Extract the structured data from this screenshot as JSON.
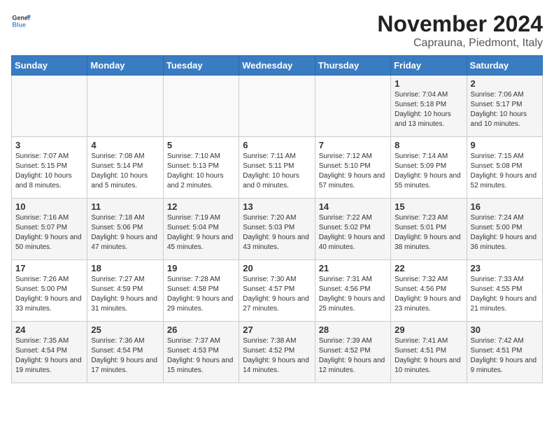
{
  "header": {
    "logo": {
      "text_general": "General",
      "text_blue": "Blue"
    },
    "title": "November 2024",
    "subtitle": "Caprauna, Piedmont, Italy"
  },
  "calendar": {
    "weekdays": [
      "Sunday",
      "Monday",
      "Tuesday",
      "Wednesday",
      "Thursday",
      "Friday",
      "Saturday"
    ],
    "weeks": [
      [
        {
          "day": "",
          "info": ""
        },
        {
          "day": "",
          "info": ""
        },
        {
          "day": "",
          "info": ""
        },
        {
          "day": "",
          "info": ""
        },
        {
          "day": "",
          "info": ""
        },
        {
          "day": "1",
          "info": "Sunrise: 7:04 AM\nSunset: 5:18 PM\nDaylight: 10 hours and 13 minutes."
        },
        {
          "day": "2",
          "info": "Sunrise: 7:06 AM\nSunset: 5:17 PM\nDaylight: 10 hours and 10 minutes."
        }
      ],
      [
        {
          "day": "3",
          "info": "Sunrise: 7:07 AM\nSunset: 5:15 PM\nDaylight: 10 hours and 8 minutes."
        },
        {
          "day": "4",
          "info": "Sunrise: 7:08 AM\nSunset: 5:14 PM\nDaylight: 10 hours and 5 minutes."
        },
        {
          "day": "5",
          "info": "Sunrise: 7:10 AM\nSunset: 5:13 PM\nDaylight: 10 hours and 2 minutes."
        },
        {
          "day": "6",
          "info": "Sunrise: 7:11 AM\nSunset: 5:11 PM\nDaylight: 10 hours and 0 minutes."
        },
        {
          "day": "7",
          "info": "Sunrise: 7:12 AM\nSunset: 5:10 PM\nDaylight: 9 hours and 57 minutes."
        },
        {
          "day": "8",
          "info": "Sunrise: 7:14 AM\nSunset: 5:09 PM\nDaylight: 9 hours and 55 minutes."
        },
        {
          "day": "9",
          "info": "Sunrise: 7:15 AM\nSunset: 5:08 PM\nDaylight: 9 hours and 52 minutes."
        }
      ],
      [
        {
          "day": "10",
          "info": "Sunrise: 7:16 AM\nSunset: 5:07 PM\nDaylight: 9 hours and 50 minutes."
        },
        {
          "day": "11",
          "info": "Sunrise: 7:18 AM\nSunset: 5:06 PM\nDaylight: 9 hours and 47 minutes."
        },
        {
          "day": "12",
          "info": "Sunrise: 7:19 AM\nSunset: 5:04 PM\nDaylight: 9 hours and 45 minutes."
        },
        {
          "day": "13",
          "info": "Sunrise: 7:20 AM\nSunset: 5:03 PM\nDaylight: 9 hours and 43 minutes."
        },
        {
          "day": "14",
          "info": "Sunrise: 7:22 AM\nSunset: 5:02 PM\nDaylight: 9 hours and 40 minutes."
        },
        {
          "day": "15",
          "info": "Sunrise: 7:23 AM\nSunset: 5:01 PM\nDaylight: 9 hours and 38 minutes."
        },
        {
          "day": "16",
          "info": "Sunrise: 7:24 AM\nSunset: 5:00 PM\nDaylight: 9 hours and 36 minutes."
        }
      ],
      [
        {
          "day": "17",
          "info": "Sunrise: 7:26 AM\nSunset: 5:00 PM\nDaylight: 9 hours and 33 minutes."
        },
        {
          "day": "18",
          "info": "Sunrise: 7:27 AM\nSunset: 4:59 PM\nDaylight: 9 hours and 31 minutes."
        },
        {
          "day": "19",
          "info": "Sunrise: 7:28 AM\nSunset: 4:58 PM\nDaylight: 9 hours and 29 minutes."
        },
        {
          "day": "20",
          "info": "Sunrise: 7:30 AM\nSunset: 4:57 PM\nDaylight: 9 hours and 27 minutes."
        },
        {
          "day": "21",
          "info": "Sunrise: 7:31 AM\nSunset: 4:56 PM\nDaylight: 9 hours and 25 minutes."
        },
        {
          "day": "22",
          "info": "Sunrise: 7:32 AM\nSunset: 4:56 PM\nDaylight: 9 hours and 23 minutes."
        },
        {
          "day": "23",
          "info": "Sunrise: 7:33 AM\nSunset: 4:55 PM\nDaylight: 9 hours and 21 minutes."
        }
      ],
      [
        {
          "day": "24",
          "info": "Sunrise: 7:35 AM\nSunset: 4:54 PM\nDaylight: 9 hours and 19 minutes."
        },
        {
          "day": "25",
          "info": "Sunrise: 7:36 AM\nSunset: 4:54 PM\nDaylight: 9 hours and 17 minutes."
        },
        {
          "day": "26",
          "info": "Sunrise: 7:37 AM\nSunset: 4:53 PM\nDaylight: 9 hours and 15 minutes."
        },
        {
          "day": "27",
          "info": "Sunrise: 7:38 AM\nSunset: 4:52 PM\nDaylight: 9 hours and 14 minutes."
        },
        {
          "day": "28",
          "info": "Sunrise: 7:39 AM\nSunset: 4:52 PM\nDaylight: 9 hours and 12 minutes."
        },
        {
          "day": "29",
          "info": "Sunrise: 7:41 AM\nSunset: 4:51 PM\nDaylight: 9 hours and 10 minutes."
        },
        {
          "day": "30",
          "info": "Sunrise: 7:42 AM\nSunset: 4:51 PM\nDaylight: 9 hours and 9 minutes."
        }
      ]
    ]
  }
}
